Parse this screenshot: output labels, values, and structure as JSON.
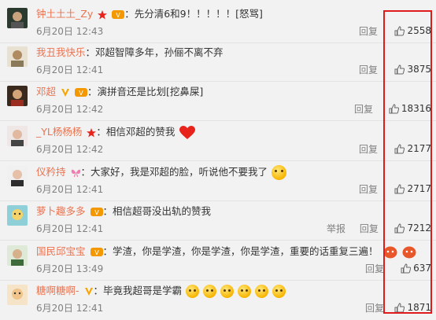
{
  "comments": [
    {
      "user": "钟土土土_Zy",
      "text": "先分清6和9！！！！！[怒骂]",
      "time": "6月20日 12:43",
      "actions": [
        "回复"
      ],
      "likes": "2558"
    },
    {
      "user": "我丑我快乐",
      "text": "邓超智障多年，孙俪不离不弃",
      "time": "6月20日 12:41",
      "actions": [
        "回复"
      ],
      "likes": "3875"
    },
    {
      "user": "邓超",
      "text": "演拼音还是比划[挖鼻屎]",
      "time": "6月20日 12:42",
      "actions": [
        "回复"
      ],
      "likes": "18316"
    },
    {
      "user": "_YL杨杨杨",
      "text": "相信邓超的赞我",
      "time": "6月20日 12:42",
      "actions": [
        "回复"
      ],
      "likes": "2177"
    },
    {
      "user": "仪矜持",
      "text": "大家好，我是邓超的脸，听说他不要我了",
      "time": "6月20日 12:41",
      "actions": [
        "回复"
      ],
      "likes": "2717"
    },
    {
      "user": "萝卜趣多多",
      "text": "相信超哥没出轨的赞我",
      "time": "6月20日 12:41",
      "actions": [
        "举报",
        "回复"
      ],
      "likes": "7212"
    },
    {
      "user": "国民邱宝宝",
      "text": "学渣，你是学渣，你是学渣，你是学渣，重要的话重复三遍！",
      "time": "6月20日 13:49",
      "actions": [
        "回复"
      ],
      "likes": "637"
    },
    {
      "user": "糖啊糖啊-",
      "text": "毕竟我超哥是学霸",
      "time": "6月20日 12:41",
      "actions": [
        "回复"
      ],
      "likes": "1871"
    }
  ],
  "icons": {
    "like": "thumbs-up-icon",
    "avatar": "user-avatar"
  },
  "colors": {
    "username": "#eb7350",
    "highlight": "#e01b1b",
    "muted": "#808080"
  }
}
